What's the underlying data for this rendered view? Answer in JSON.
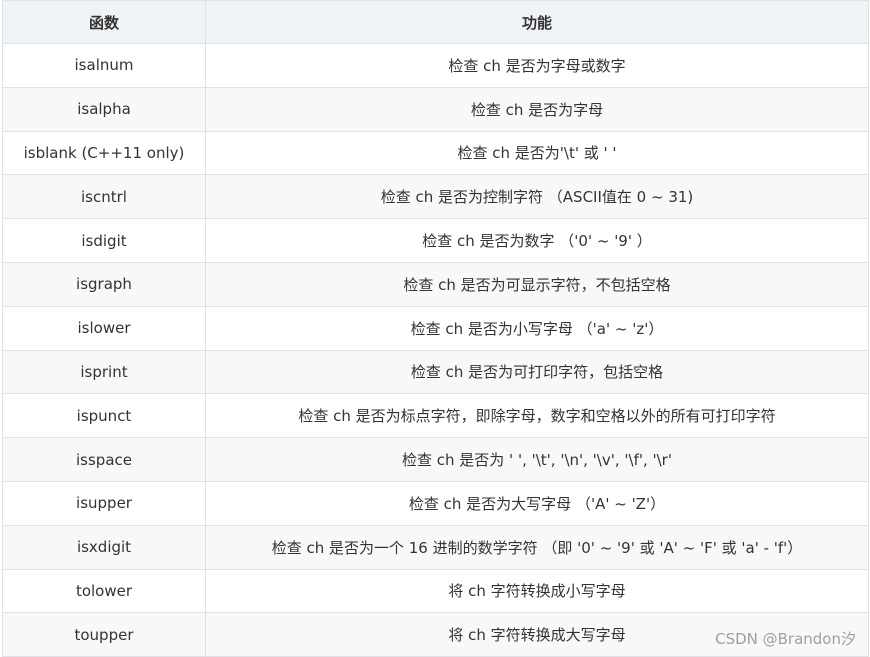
{
  "table": {
    "headers": [
      "函数",
      "功能"
    ],
    "rows": [
      {
        "func": "isalnum",
        "desc": "检查 ch 是否为字母或数字"
      },
      {
        "func": "isalpha",
        "desc": "检查 ch 是否为字母"
      },
      {
        "func": "isblank (C++11 only)",
        "desc": "检查 ch 是否为'\\t' 或 ' '"
      },
      {
        "func": "iscntrl",
        "desc": "检查 ch 是否为控制字符 （ASCII值在 0 ~ 31)"
      },
      {
        "func": "isdigit",
        "desc": "检查 ch 是否为数字 （'0' ~ '9' ）"
      },
      {
        "func": "isgraph",
        "desc": "检查 ch 是否为可显示字符，不包括空格"
      },
      {
        "func": "islower",
        "desc": "检查 ch 是否为小写字母 （'a' ~ 'z'）"
      },
      {
        "func": "isprint",
        "desc": "检查 ch 是否为可打印字符，包括空格"
      },
      {
        "func": "ispunct",
        "desc": "检查 ch 是否为标点字符，即除字母，数字和空格以外的所有可打印字符"
      },
      {
        "func": "isspace",
        "desc": "检查 ch 是否为 ' ', '\\t', '\\n', '\\v', '\\f', '\\r'"
      },
      {
        "func": "isupper",
        "desc": "检查 ch 是否为大写字母 （'A' ~ 'Z'）"
      },
      {
        "func": "isxdigit",
        "desc": "检查 ch 是否为一个 16 进制的数学字符 （即 '0' ~ '9' 或 'A' ~ 'F' 或 'a' - 'f'）"
      },
      {
        "func": "tolower",
        "desc": "将 ch 字符转换成小写字母"
      },
      {
        "func": "toupper",
        "desc": "将 ch 字符转换成大写字母"
      }
    ]
  },
  "watermark": "CSDN @Brandon汐"
}
